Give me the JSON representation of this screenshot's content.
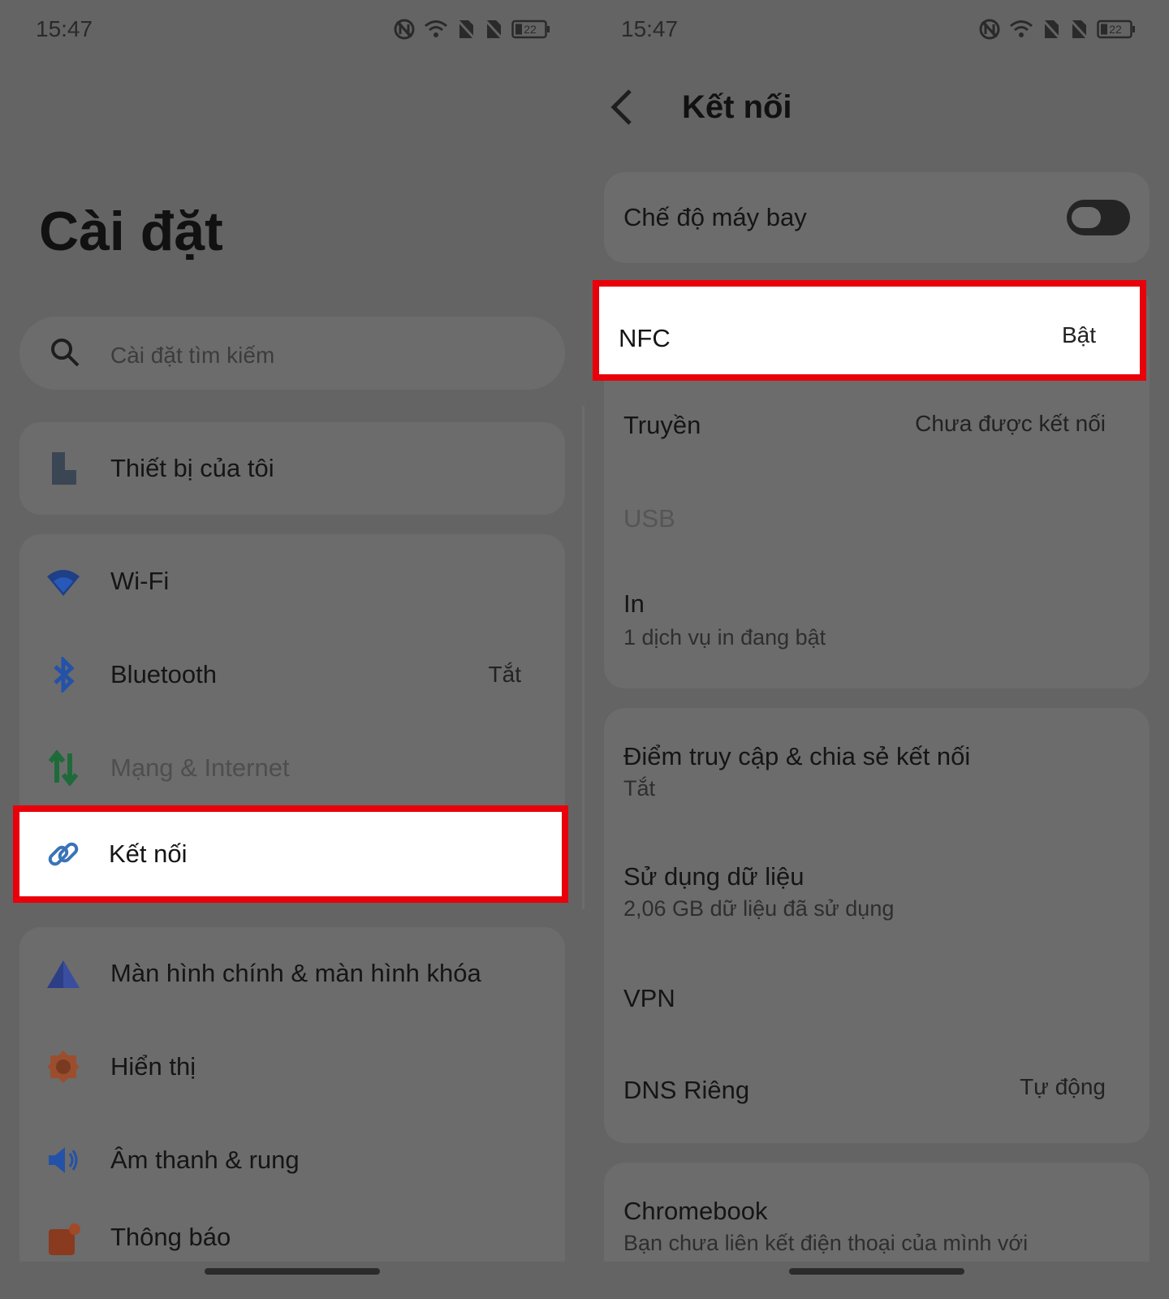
{
  "status_bar": {
    "time": "15:47",
    "battery": "22"
  },
  "left": {
    "title": "Cài đặt",
    "search_placeholder": "Cài đặt tìm kiếm",
    "device_item": "Thiết bị của tôi",
    "items": [
      {
        "label": "Wi-Fi",
        "value": ""
      },
      {
        "label": "Bluetooth",
        "value": "Tắt"
      },
      {
        "label": "Mạng & Internet",
        "value": ""
      },
      {
        "label": "Kết nối",
        "value": ""
      }
    ],
    "items2": [
      {
        "label": "Màn hình chính & màn hình khóa"
      },
      {
        "label": "Hiển thị"
      },
      {
        "label": "Âm thanh & rung"
      },
      {
        "label": "Thông báo"
      }
    ]
  },
  "right": {
    "title": "Kết nối",
    "airplane": {
      "label": "Chế độ máy bay",
      "on": false
    },
    "nfc": {
      "label": "NFC",
      "value": "Bật"
    },
    "cast": {
      "label": "Truyền",
      "value": "Chưa được kết nối"
    },
    "usb": {
      "label": "USB"
    },
    "print": {
      "label": "In",
      "sub": "1 dịch vụ in đang bật"
    },
    "hotspot": {
      "label": "Điểm truy cập & chia sẻ kết nối",
      "sub": "Tắt"
    },
    "data_usage": {
      "label": "Sử dụng dữ liệu",
      "sub": "2,06 GB dữ liệu đã sử dụng"
    },
    "vpn": {
      "label": "VPN"
    },
    "dns": {
      "label": "DNS Riêng",
      "value": "Tự động"
    },
    "chromebook": {
      "label": "Chromebook",
      "sub": "Bạn chưa liên kết điện thoại của mình với"
    }
  },
  "colors": {
    "highlight_border": "#e8000a",
    "highlight_fill": "#ffffff",
    "background": "#646464",
    "card": "#6c6c6c"
  }
}
